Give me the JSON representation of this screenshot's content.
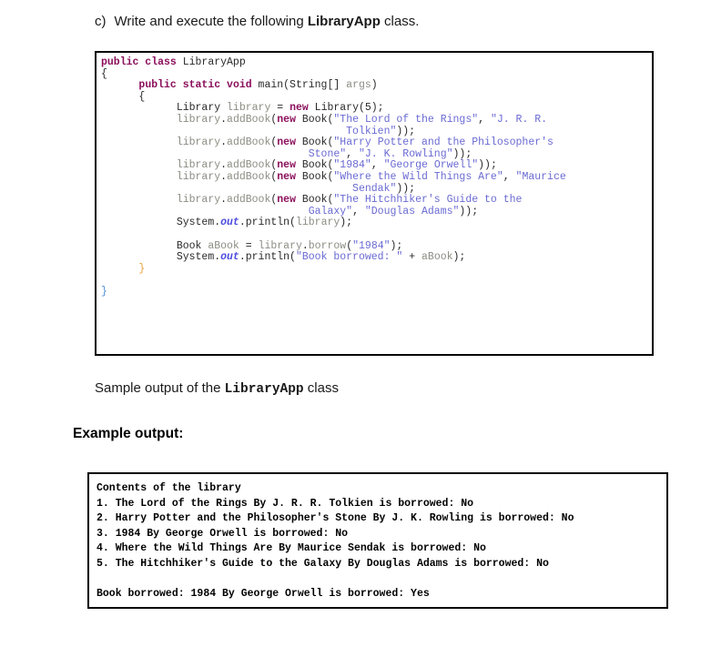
{
  "question": {
    "marker": "c)",
    "text_before": "Write and execute the following ",
    "class_name": "LibraryApp",
    "text_after": " class."
  },
  "code_block": {
    "language": "java",
    "lines": [
      [
        {
          "t": "public class ",
          "c": "k"
        },
        {
          "t": "LibraryApp",
          "c": "pln"
        }
      ],
      [
        {
          "t": "{",
          "c": "pln"
        }
      ],
      [
        {
          "t": "      ",
          "c": "pln"
        },
        {
          "t": "public static void ",
          "c": "k"
        },
        {
          "t": "main(String[] ",
          "c": "pln"
        },
        {
          "t": "args",
          "c": "id"
        },
        {
          "t": ")",
          "c": "pln"
        }
      ],
      [
        {
          "t": "      {",
          "c": "pln"
        }
      ],
      [
        {
          "t": "            Library ",
          "c": "pln"
        },
        {
          "t": "library",
          "c": "id"
        },
        {
          "t": " = ",
          "c": "pln"
        },
        {
          "t": "new ",
          "c": "k"
        },
        {
          "t": "Library(5);",
          "c": "pln"
        }
      ],
      [
        {
          "t": "            ",
          "c": "pln"
        },
        {
          "t": "library",
          "c": "id"
        },
        {
          "t": ".",
          "c": "pln"
        },
        {
          "t": "addBook",
          "c": "id"
        },
        {
          "t": "(",
          "c": "pln"
        },
        {
          "t": "new ",
          "c": "k"
        },
        {
          "t": "Book(",
          "c": "pln"
        },
        {
          "t": "\"The Lord of the Rings\"",
          "c": "str"
        },
        {
          "t": ", ",
          "c": "pln"
        },
        {
          "t": "\"J. R. R.",
          "c": "str"
        }
      ],
      [
        {
          "t": "                                       ",
          "c": "pln"
        },
        {
          "t": "Tolkien\"",
          "c": "str"
        },
        {
          "t": "));",
          "c": "pln"
        }
      ],
      [
        {
          "t": "            ",
          "c": "pln"
        },
        {
          "t": "library",
          "c": "id"
        },
        {
          "t": ".",
          "c": "pln"
        },
        {
          "t": "addBook",
          "c": "id"
        },
        {
          "t": "(",
          "c": "pln"
        },
        {
          "t": "new ",
          "c": "k"
        },
        {
          "t": "Book(",
          "c": "pln"
        },
        {
          "t": "\"Harry Potter and the Philosopher's",
          "c": "str"
        }
      ],
      [
        {
          "t": "                                 ",
          "c": "pln"
        },
        {
          "t": "Stone\"",
          "c": "str"
        },
        {
          "t": ", ",
          "c": "pln"
        },
        {
          "t": "\"J. K. Rowling\"",
          "c": "str"
        },
        {
          "t": "));",
          "c": "pln"
        }
      ],
      [
        {
          "t": "            ",
          "c": "pln"
        },
        {
          "t": "library",
          "c": "id"
        },
        {
          "t": ".",
          "c": "pln"
        },
        {
          "t": "addBook",
          "c": "id"
        },
        {
          "t": "(",
          "c": "pln"
        },
        {
          "t": "new ",
          "c": "k"
        },
        {
          "t": "Book(",
          "c": "pln"
        },
        {
          "t": "\"1984\"",
          "c": "str"
        },
        {
          "t": ", ",
          "c": "pln"
        },
        {
          "t": "\"George Orwell\"",
          "c": "str"
        },
        {
          "t": "));",
          "c": "pln"
        }
      ],
      [
        {
          "t": "            ",
          "c": "pln"
        },
        {
          "t": "library",
          "c": "id"
        },
        {
          "t": ".",
          "c": "pln"
        },
        {
          "t": "addBook",
          "c": "id"
        },
        {
          "t": "(",
          "c": "pln"
        },
        {
          "t": "new ",
          "c": "k"
        },
        {
          "t": "Book(",
          "c": "pln"
        },
        {
          "t": "\"Where the Wild Things Are\"",
          "c": "str"
        },
        {
          "t": ", ",
          "c": "pln"
        },
        {
          "t": "\"Maurice",
          "c": "str"
        }
      ],
      [
        {
          "t": "                                        ",
          "c": "pln"
        },
        {
          "t": "Sendak\"",
          "c": "str"
        },
        {
          "t": "));",
          "c": "pln"
        }
      ],
      [
        {
          "t": "            ",
          "c": "pln"
        },
        {
          "t": "library",
          "c": "id"
        },
        {
          "t": ".",
          "c": "pln"
        },
        {
          "t": "addBook",
          "c": "id"
        },
        {
          "t": "(",
          "c": "pln"
        },
        {
          "t": "new ",
          "c": "k"
        },
        {
          "t": "Book(",
          "c": "pln"
        },
        {
          "t": "\"The Hitchhiker's Guide to the",
          "c": "str"
        }
      ],
      [
        {
          "t": "                                 ",
          "c": "pln"
        },
        {
          "t": "Galaxy\"",
          "c": "str"
        },
        {
          "t": ", ",
          "c": "pln"
        },
        {
          "t": "\"Douglas Adams\"",
          "c": "str"
        },
        {
          "t": "));",
          "c": "pln"
        }
      ],
      [
        {
          "t": "            System.",
          "c": "pln"
        },
        {
          "t": "out",
          "c": "fld"
        },
        {
          "t": ".println(",
          "c": "pln"
        },
        {
          "t": "library",
          "c": "id"
        },
        {
          "t": ");",
          "c": "pln"
        }
      ],
      [
        {
          "t": "",
          "c": "pln"
        }
      ],
      [
        {
          "t": "            Book ",
          "c": "pln"
        },
        {
          "t": "aBook",
          "c": "id"
        },
        {
          "t": " = ",
          "c": "pln"
        },
        {
          "t": "library",
          "c": "id"
        },
        {
          "t": ".",
          "c": "pln"
        },
        {
          "t": "borrow",
          "c": "id"
        },
        {
          "t": "(",
          "c": "pln"
        },
        {
          "t": "\"1984\"",
          "c": "str"
        },
        {
          "t": ");",
          "c": "pln"
        }
      ],
      [
        {
          "t": "            System.",
          "c": "pln"
        },
        {
          "t": "out",
          "c": "fld"
        },
        {
          "t": ".println(",
          "c": "pln"
        },
        {
          "t": "\"Book borrowed: \"",
          "c": "str"
        },
        {
          "t": " + ",
          "c": "pln"
        },
        {
          "t": "aBook",
          "c": "id"
        },
        {
          "t": ");",
          "c": "pln"
        }
      ],
      [
        {
          "t": "      ",
          "c": "pln"
        },
        {
          "t": "}",
          "c": "br1"
        }
      ],
      [
        {
          "t": "",
          "c": "pln"
        }
      ],
      [
        {
          "t": "}",
          "c": "br2"
        }
      ]
    ]
  },
  "sample_caption": {
    "text_before": "Sample output of the ",
    "class_name": "LibraryApp",
    "text_after": " class"
  },
  "example_heading": "Example output:",
  "output_block": {
    "lines": [
      "Contents of the library",
      "1. The Lord of the Rings By J. R. R. Tolkien is borrowed: No",
      "2. Harry Potter and the Philosopher's Stone By J. K. Rowling is borrowed: No",
      "3. 1984 By George Orwell is borrowed: No",
      "4. Where the Wild Things Are By Maurice Sendak is borrowed: No",
      "5. The Hitchhiker's Guide to the Galaxy By Douglas Adams is borrowed: No",
      "",
      "Book borrowed: 1984 By George Orwell is borrowed: Yes"
    ]
  },
  "colors": {
    "keyword": "#8b0f5c",
    "string": "#6a6ad3",
    "identifier": "#8d8d84",
    "field": "#4b4be0",
    "plain": "#2a2a2a",
    "border": "#000000",
    "background": "#ffffff"
  }
}
